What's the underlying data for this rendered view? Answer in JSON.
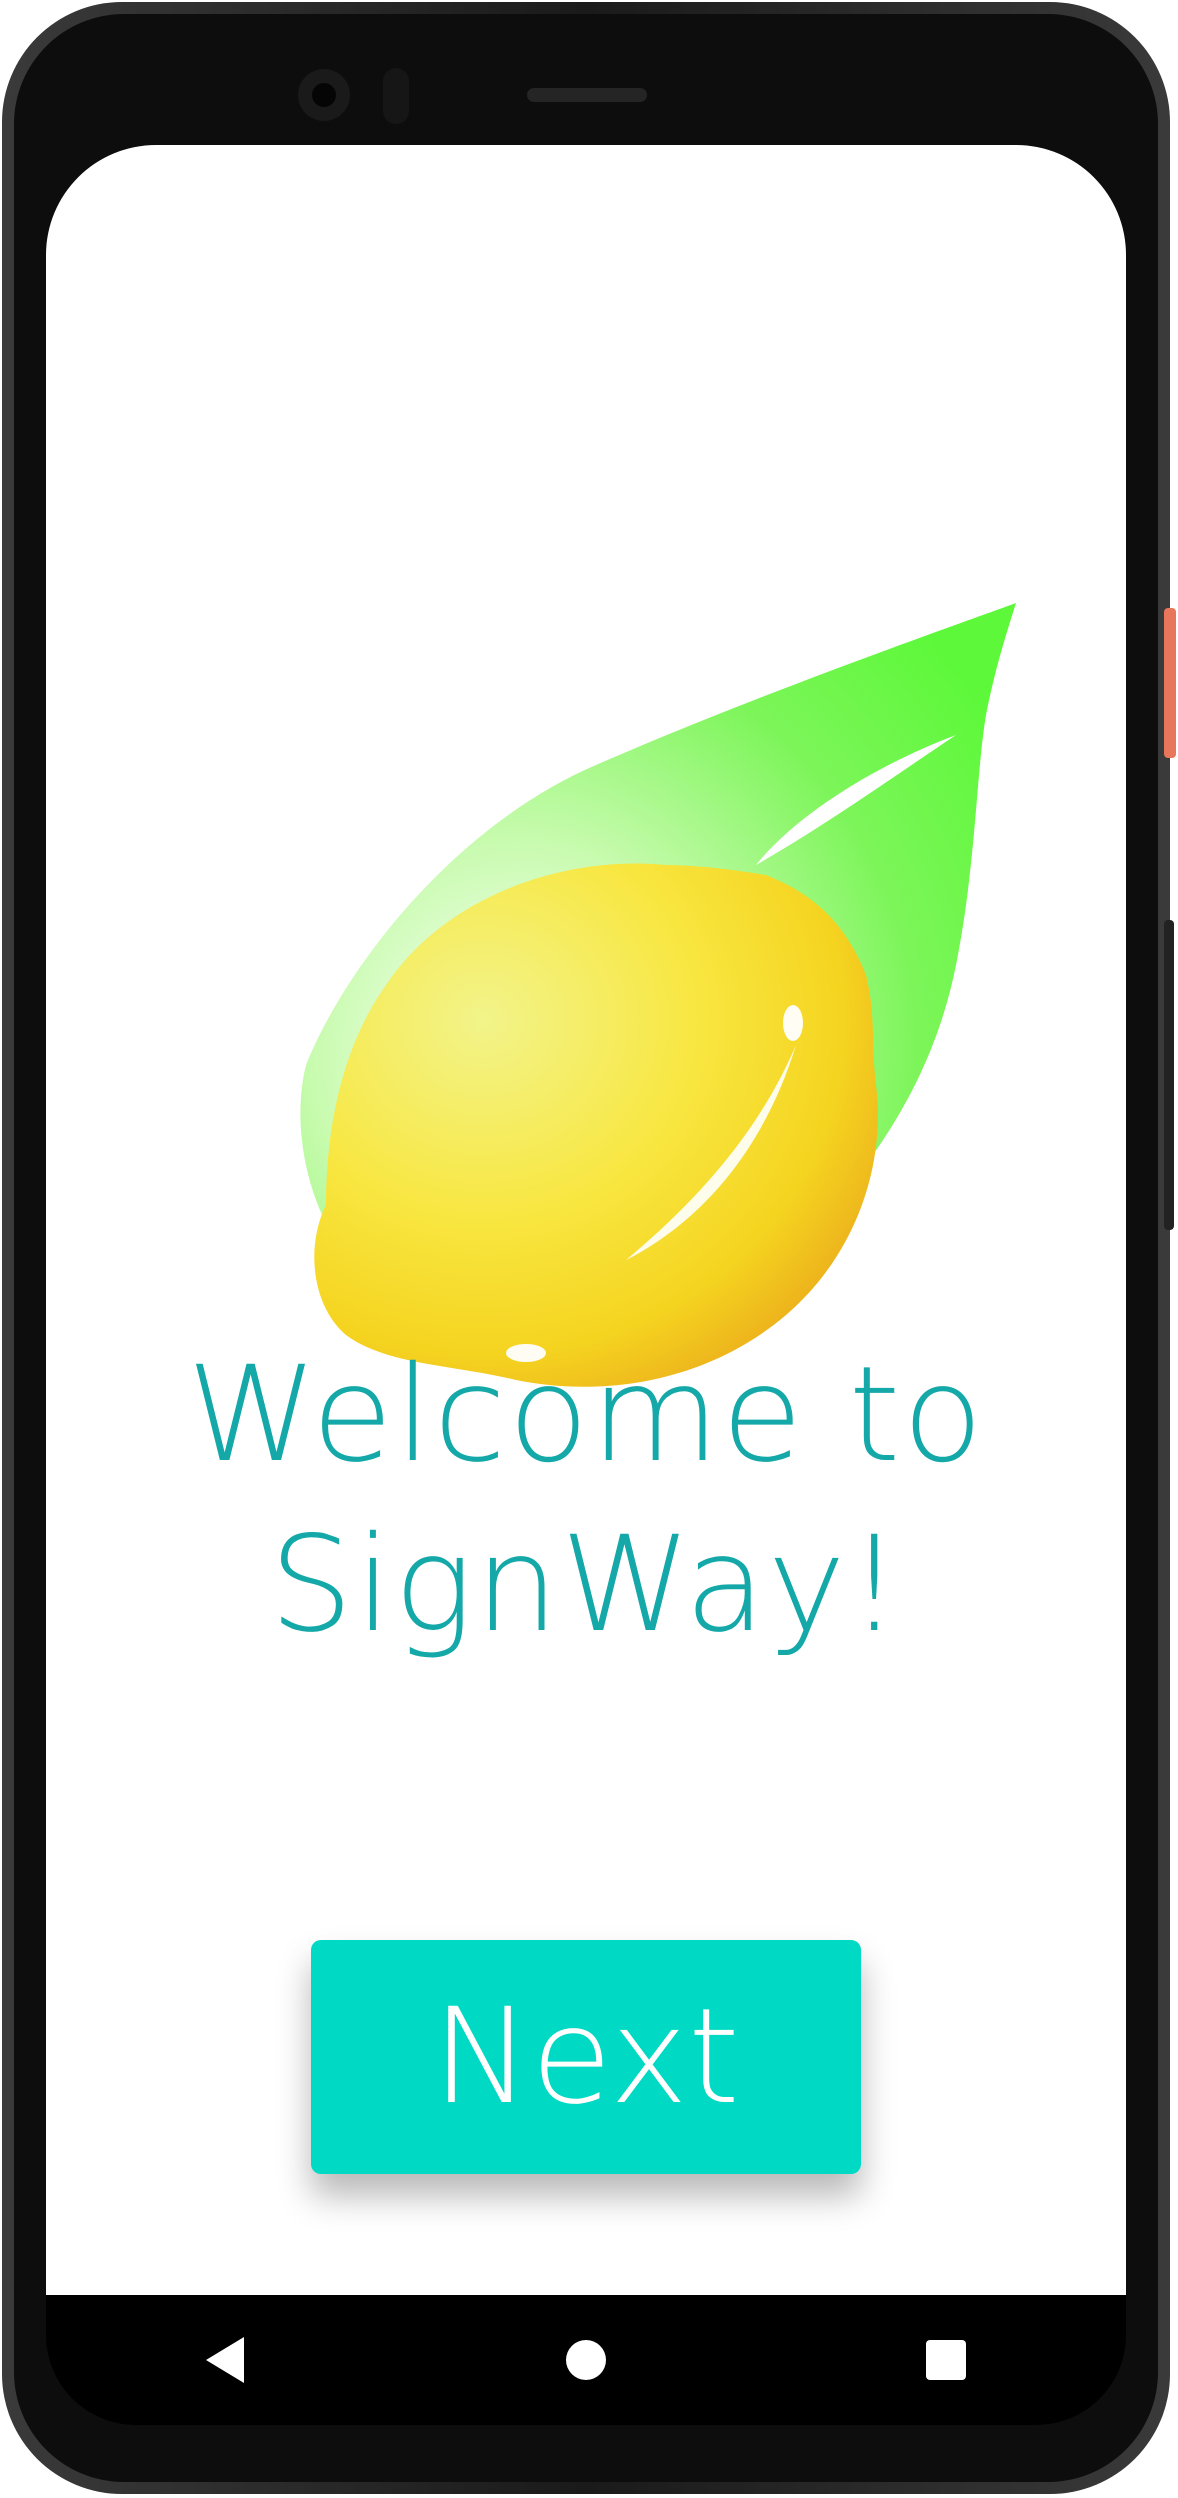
{
  "app": {
    "name": "SignWay",
    "brand_colors": {
      "title": "#14a8a8",
      "button": "#00d9c4",
      "leaf": "#5ef83a",
      "lemon": "#f5d420"
    }
  },
  "welcome": {
    "line1": "Welcome to",
    "line2": "SignWay!",
    "logo_icon": "lemon-leaf-logo"
  },
  "actions": {
    "next_label": "Next"
  },
  "nav_bar": {
    "back_icon": "back-triangle-icon",
    "home_icon": "home-circle-icon",
    "recents_icon": "recents-square-icon"
  }
}
